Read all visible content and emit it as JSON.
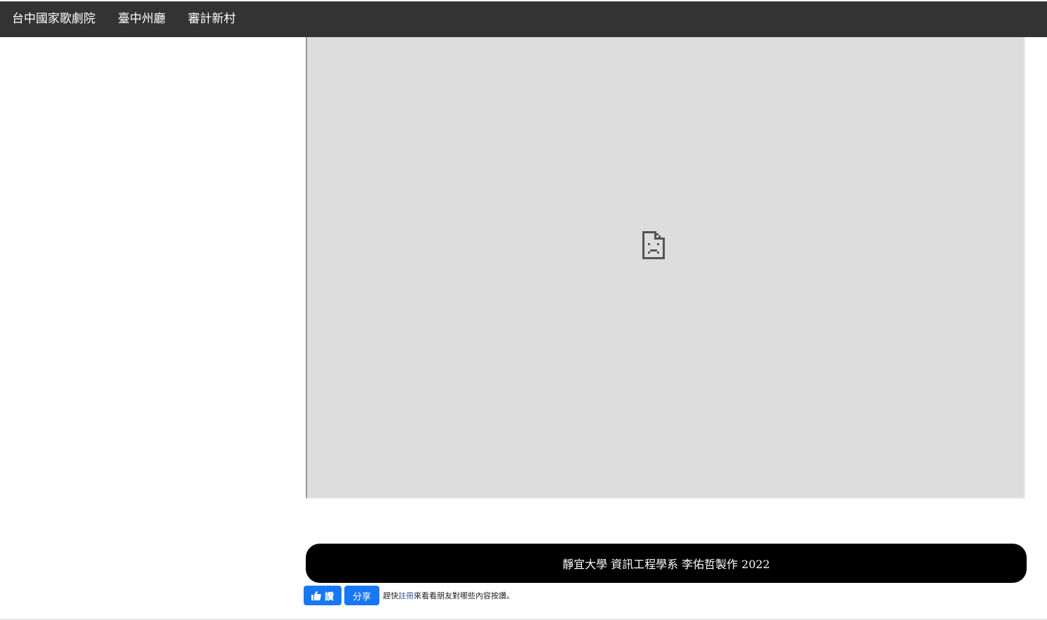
{
  "nav": {
    "items": [
      {
        "label": "台中國家歌劇院"
      },
      {
        "label": "臺中州廳"
      },
      {
        "label": "審計新村"
      }
    ]
  },
  "embed": {
    "icon": "broken-document-icon",
    "background": "#dddddd"
  },
  "footer": {
    "text": "靜宜大學 資訊工程學系 李佑哲製作 2022"
  },
  "facebook": {
    "like_label": "讚",
    "share_label": "分享",
    "prompt_link": "註冊",
    "prompt_prefix": "趕快",
    "prompt_suffix": "來看看朋友對哪些內容按讚。",
    "accent": "#1877f2"
  }
}
